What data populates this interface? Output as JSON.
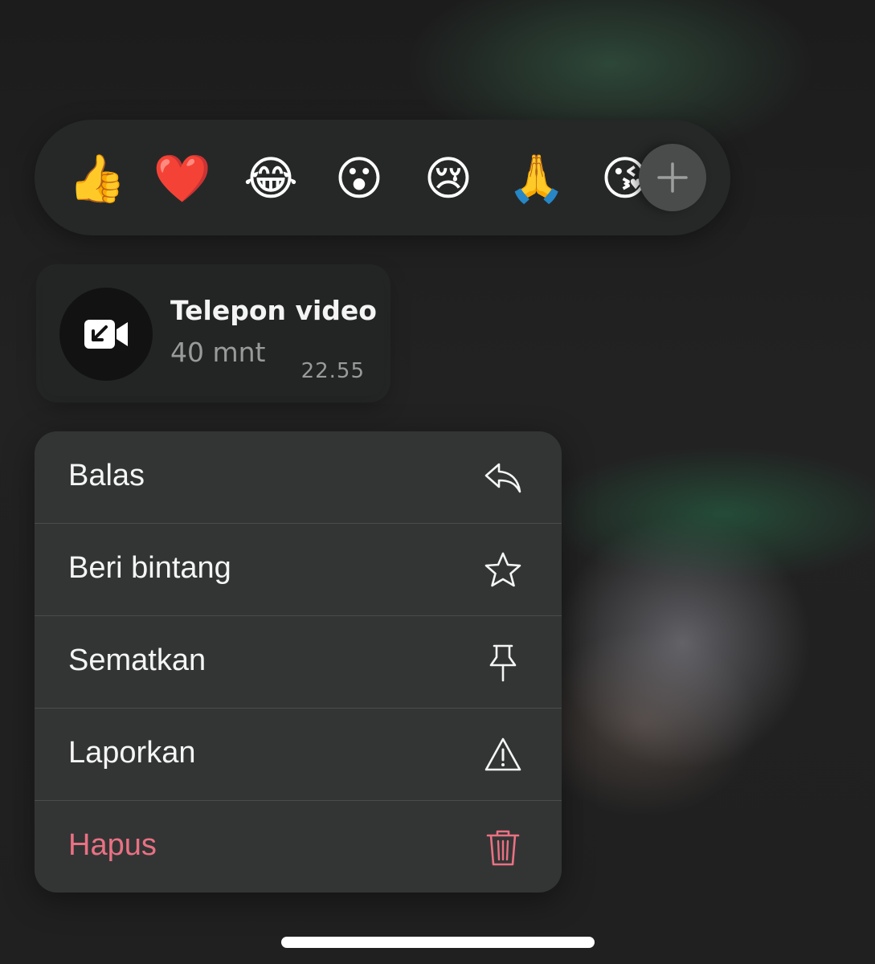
{
  "reactions": {
    "emojis": [
      "👍",
      "❤️",
      "😂",
      "😮",
      "😢",
      "🙏",
      "😘"
    ],
    "add_icon": "plus-icon"
  },
  "call": {
    "icon": "incoming-video-call-icon",
    "title": "Telepon video",
    "duration": "40 mnt",
    "time": "22.55"
  },
  "menu": {
    "items": [
      {
        "label": "Balas",
        "icon": "reply-icon"
      },
      {
        "label": "Beri bintang",
        "icon": "star-icon"
      },
      {
        "label": "Sematkan",
        "icon": "pin-icon"
      },
      {
        "label": "Laporkan",
        "icon": "warning-icon"
      },
      {
        "label": "Hapus",
        "icon": "trash-icon"
      }
    ]
  },
  "colors": {
    "danger": "#ea7183",
    "menu_background": "#343636",
    "bubble_background": "#232525"
  }
}
